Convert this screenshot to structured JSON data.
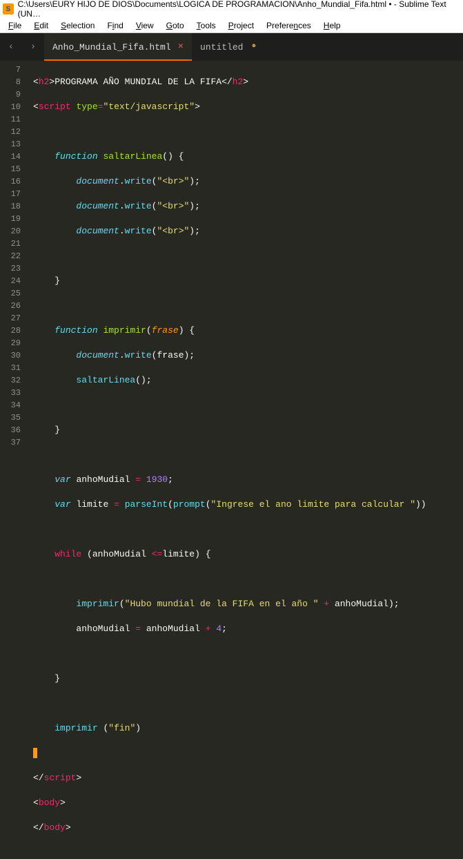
{
  "window": {
    "title": "C:\\Users\\EURY HIJO DE DIOS\\Documents\\LOGICA DE PROGRAMACION\\Anho_Mundial_Fifa.html • - Sublime Text (UN…",
    "app_icon_letter": "S"
  },
  "menu": {
    "file": "File",
    "edit": "Edit",
    "selection": "Selection",
    "find": "Find",
    "view": "View",
    "goto": "Goto",
    "tools": "Tools",
    "project": "Project",
    "preferences": "Preferences",
    "help": "Help"
  },
  "nav": {
    "back": "‹",
    "forward": "›"
  },
  "tabs": [
    {
      "label": "Anho_Mundial_Fifa.html",
      "active": true,
      "dirty": false
    },
    {
      "label": "untitled",
      "active": false,
      "dirty": true
    }
  ],
  "gutter_start": 7,
  "gutter_end": 37,
  "code": {
    "l7": {
      "h2o": "h2",
      "text": "PROGRAMA AÑO MUNDIAL DE LA FIFA",
      "h2c": "h2"
    },
    "l8": {
      "tag": "script",
      "attr": "type",
      "eq": "=",
      "val": "\"text/javascript\""
    },
    "l10": {
      "kw": "function",
      "name": "saltarLinea"
    },
    "l11": {
      "obj": "document",
      "m": "write",
      "arg": "\"<br>\""
    },
    "l12": {
      "obj": "document",
      "m": "write",
      "arg": "\"<br>\""
    },
    "l13": {
      "obj": "document",
      "m": "write",
      "arg": "\"<br>\""
    },
    "l17": {
      "kw": "function",
      "name": "imprimir",
      "param": "frase"
    },
    "l18": {
      "obj": "document",
      "m": "write",
      "arg": "frase"
    },
    "l19": {
      "call": "saltarLinea"
    },
    "l23": {
      "kw": "var",
      "name": "anhoMudial",
      "eq": "=",
      "val": "1930"
    },
    "l24": {
      "kw": "var",
      "name": "limite",
      "eq": "=",
      "fn": "parseInt",
      "fn2": "prompt",
      "str": "\"Ingrese el ano limite para calcular \""
    },
    "l26": {
      "kw": "while",
      "v1": "anhoMudial",
      "op": "<=",
      "v2": "limite"
    },
    "l28": {
      "fn": "imprimir",
      "str": "\"Hubo mundial de la FIFA en el año \"",
      "plus": "+",
      "v": "anhoMudial"
    },
    "l29": {
      "v": "anhoMudial",
      "eq": "=",
      "v2": "anhoMudial",
      "plus": "+",
      "n": "4"
    },
    "l33": {
      "fn": "imprimir",
      "str": "\"fin\""
    },
    "l35": {
      "tag": "script"
    },
    "l36": {
      "tag": "body"
    },
    "l37": {
      "tag": "body"
    }
  }
}
